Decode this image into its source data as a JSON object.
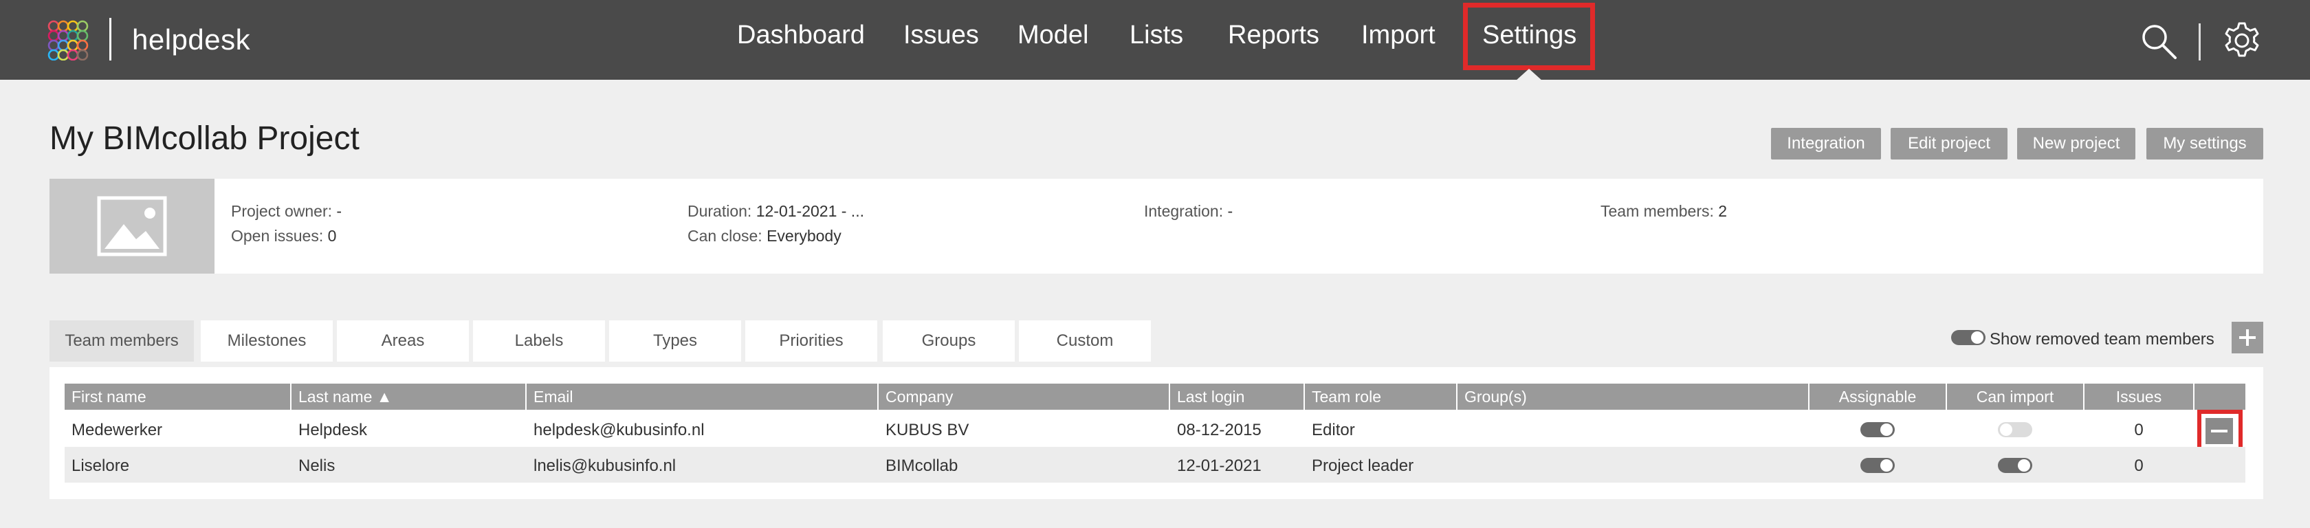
{
  "app": {
    "brand": "helpdesk"
  },
  "nav": {
    "items": [
      {
        "label": "Dashboard"
      },
      {
        "label": "Issues"
      },
      {
        "label": "Model"
      },
      {
        "label": "Lists"
      },
      {
        "label": "Reports"
      },
      {
        "label": "Import"
      },
      {
        "label": "Settings",
        "active": true
      }
    ]
  },
  "header": {
    "title": "My BIMcollab Project",
    "buttons": [
      "Integration",
      "Edit project",
      "New project",
      "My settings"
    ]
  },
  "info": {
    "project_owner_label": "Project owner:",
    "project_owner": "-",
    "open_issues_label": "Open issues:",
    "open_issues": "0",
    "duration_label": "Duration:",
    "duration": "12-01-2021 - ...",
    "can_close_label": "Can close:",
    "can_close": "Everybody",
    "integration_label": "Integration:",
    "integration": "-",
    "team_members_label": "Team members:",
    "team_members": "2"
  },
  "tabs": [
    {
      "label": "Team members",
      "active": true
    },
    {
      "label": "Milestones"
    },
    {
      "label": "Areas"
    },
    {
      "label": "Labels"
    },
    {
      "label": "Types"
    },
    {
      "label": "Priorities"
    },
    {
      "label": "Groups"
    },
    {
      "label": "Custom"
    }
  ],
  "show_removed": {
    "label": "Show removed team members",
    "on": true
  },
  "table": {
    "columns": [
      "First name",
      "Last name ▲",
      "Email",
      "Company",
      "Last login",
      "Team role",
      "Group(s)",
      "Assignable",
      "Can import",
      "Issues",
      ""
    ],
    "rows": [
      {
        "first": "Medewerker",
        "last": "Helpdesk",
        "email": "helpdesk@kubusinfo.nl",
        "company": "KUBUS BV",
        "last_login": "08-12-2015",
        "role": "Editor",
        "groups": "",
        "assignable": true,
        "can_import": false,
        "issues": "0"
      },
      {
        "first": "Liselore",
        "last": "Nelis",
        "email": "lnelis@kubusinfo.nl",
        "company": "BIMcollab",
        "last_login": "12-01-2021",
        "role": "Project leader",
        "groups": "",
        "assignable": true,
        "can_import": true,
        "issues": "0"
      }
    ]
  },
  "colors": {
    "navbar": "#4a4a4a",
    "highlight": "#e02a2a",
    "button_gray": "#9a9a9a"
  }
}
